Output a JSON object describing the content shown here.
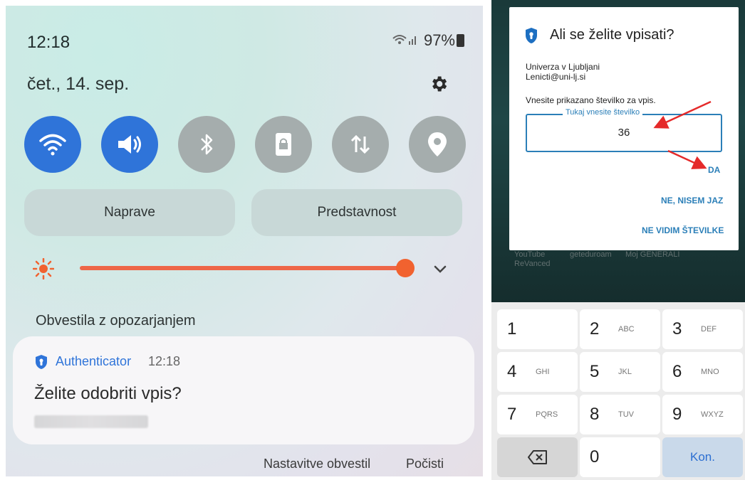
{
  "left_panel": {
    "time": "12:18",
    "battery": "97%",
    "date": "čet., 14. sep.",
    "buttons": {
      "devices": "Naprave",
      "media": "Predstavnost"
    },
    "notifications_header": "Obvestila z opozarjanjem",
    "notification": {
      "app": "Authenticator",
      "time": "12:18",
      "title": "Želite odobriti vpis?"
    },
    "footer": {
      "settings": "Nastavitve obvestil",
      "clear": "Počisti"
    },
    "quick_toggles": [
      {
        "name": "wifi-icon",
        "on": true
      },
      {
        "name": "sound-icon",
        "on": true
      },
      {
        "name": "bluetooth-icon",
        "on": false
      },
      {
        "name": "screen-lock-icon",
        "on": false
      },
      {
        "name": "data-transfer-icon",
        "on": false
      },
      {
        "name": "location-icon",
        "on": false
      }
    ],
    "brightness_level": 0.96
  },
  "right_panel": {
    "dialog": {
      "title": "Ali se želite vpisati?",
      "org": "Univerza v Ljubljani",
      "email": "Lenicti@uni-lj.si",
      "instruction": "Vnesite prikazano številko za vpis.",
      "input_label": "Tukaj vnesite številko",
      "input_value": "36",
      "btn_yes": "DA",
      "btn_not_me": "NE, NISEM JAZ",
      "btn_no_numbers": "NE VIDIM ŠTEVILKE"
    },
    "home_labels": {
      "app1_line1": "YouTube",
      "app1_line2": "ReVanced",
      "app2": "geteduroam",
      "app3": "Moj GENERALI"
    },
    "keypad": {
      "keys": [
        {
          "num": "1",
          "letters": ""
        },
        {
          "num": "2",
          "letters": "ABC"
        },
        {
          "num": "3",
          "letters": "DEF"
        },
        {
          "num": "4",
          "letters": "GHI"
        },
        {
          "num": "5",
          "letters": "JKL"
        },
        {
          "num": "6",
          "letters": "MNO"
        },
        {
          "num": "7",
          "letters": "PQRS"
        },
        {
          "num": "8",
          "letters": "TUV"
        },
        {
          "num": "9",
          "letters": "WXYZ"
        }
      ],
      "zero": "0",
      "done": "Kon."
    }
  },
  "colors": {
    "accent_blue": "#2f74d9",
    "slider_orange": "#f1622f",
    "arrow_red": "#e52a2a",
    "link_blue": "#2b7fb8"
  }
}
